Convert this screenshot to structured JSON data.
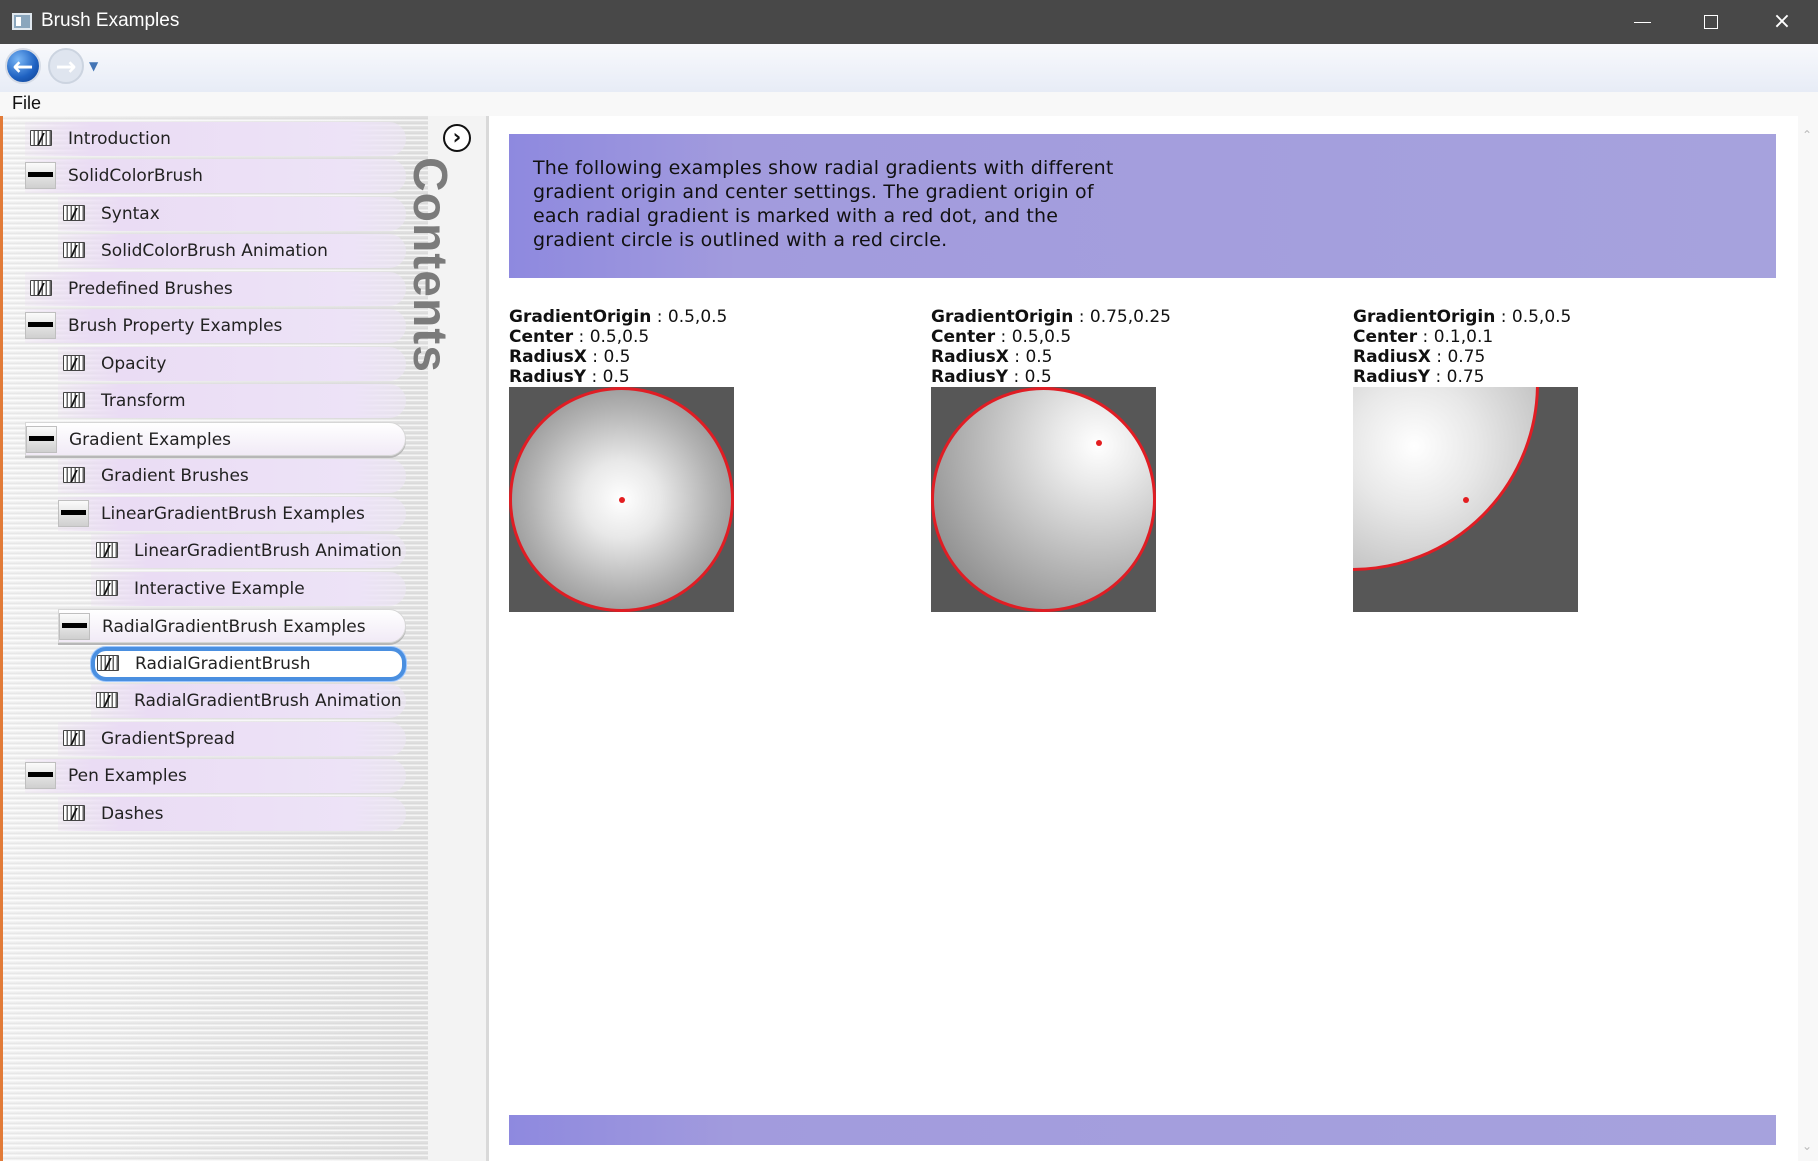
{
  "window": {
    "title": "Brush Examples",
    "minimize": "",
    "maximize": "",
    "close": "×"
  },
  "navigation": {
    "back_icon": "arrow-left-icon",
    "forward_icon": "arrow-right-icon",
    "dropdown_icon": "chevron-down-icon"
  },
  "menu": {
    "file": "File"
  },
  "tree": [
    {
      "label": "Introduction",
      "level": 0,
      "icon": "book-icon",
      "state": ""
    },
    {
      "label": "SolidColorBrush",
      "level": 0,
      "icon": "minus-icon",
      "state": ""
    },
    {
      "label": "Syntax",
      "level": 1,
      "icon": "book-icon",
      "state": ""
    },
    {
      "label": "SolidColorBrush Animation",
      "level": 1,
      "icon": "book-icon",
      "state": ""
    },
    {
      "label": "Predefined Brushes",
      "level": 0,
      "icon": "book-icon",
      "state": ""
    },
    {
      "label": "Brush Property Examples",
      "level": 0,
      "icon": "minus-icon",
      "state": ""
    },
    {
      "label": "Opacity",
      "level": 1,
      "icon": "book-icon",
      "state": ""
    },
    {
      "label": "Transform",
      "level": 1,
      "icon": "book-icon",
      "state": ""
    },
    {
      "label": "Gradient Examples",
      "level": 0,
      "icon": "minus-icon",
      "state": "active"
    },
    {
      "label": "Gradient Brushes",
      "level": 1,
      "icon": "book-icon",
      "state": ""
    },
    {
      "label": "LinearGradientBrush Examples",
      "level": 1,
      "icon": "minus-icon",
      "state": ""
    },
    {
      "label": "LinearGradientBrush Animation",
      "level": 2,
      "icon": "book-icon",
      "state": ""
    },
    {
      "label": "Interactive Example",
      "level": 2,
      "icon": "book-icon",
      "state": ""
    },
    {
      "label": "RadialGradientBrush Examples",
      "level": 1,
      "icon": "minus-icon",
      "state": "active"
    },
    {
      "label": "RadialGradientBrush",
      "level": 2,
      "icon": "book-icon",
      "state": "selected"
    },
    {
      "label": "RadialGradientBrush Animation",
      "level": 2,
      "icon": "book-icon",
      "state": ""
    },
    {
      "label": "GradientSpread",
      "level": 1,
      "icon": "book-icon",
      "state": ""
    },
    {
      "label": "Pen Examples",
      "level": 0,
      "icon": "minus-icon",
      "state": ""
    },
    {
      "label": "Dashes",
      "level": 1,
      "icon": "book-icon",
      "state": ""
    }
  ],
  "contents": {
    "label": "Contents",
    "toggle_icon": "chevron-right-icon",
    "toggle_glyph": "›"
  },
  "description": "The following examples show radial gradients with different gradient origin and center settings. The gradient origin of each radial gradient is marked with a red dot, and the gradient circle is outlined with a red circle.",
  "examples": [
    {
      "gradient_origin_label": "GradientOrigin",
      "gradient_origin": "0.5,0.5",
      "center_label": "Center",
      "center": "0.5,0.5",
      "radius_x_label": "RadiusX",
      "radius_x": "0.5",
      "radius_y_label": "RadiusY",
      "radius_y": "0.5"
    },
    {
      "gradient_origin_label": "GradientOrigin",
      "gradient_origin": "0.75,0.25",
      "center_label": "Center",
      "center": "0.5,0.5",
      "radius_x_label": "RadiusX",
      "radius_x": "0.5",
      "radius_y_label": "RadiusY",
      "radius_y": "0.5"
    },
    {
      "gradient_origin_label": "GradientOrigin",
      "gradient_origin": "0.5,0.5",
      "center_label": "Center",
      "center": "0.1,0.1",
      "radius_x_label": "RadiusX",
      "radius_x": "0.75",
      "radius_y_label": "RadiusY",
      "radius_y": "0.75"
    }
  ],
  "colors": {
    "window_title_bar": "#484848",
    "accent_purple": "#a29bdd",
    "selection_blue": "#4a8fe0",
    "gradient_outline_red": "#e01d24",
    "swatch_gray": "#575757"
  }
}
